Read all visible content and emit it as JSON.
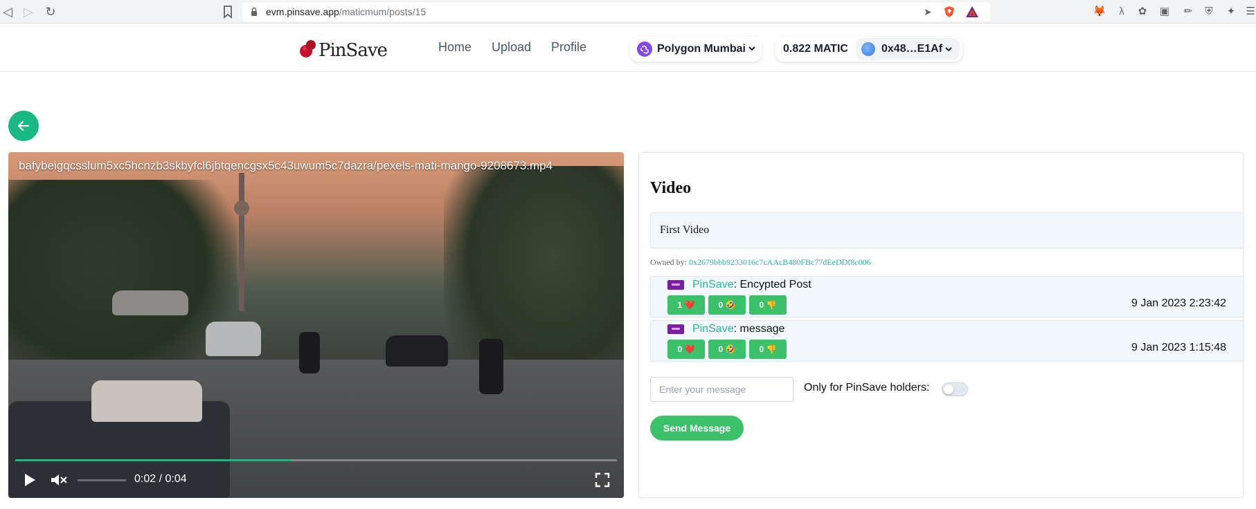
{
  "browser": {
    "url_host": "evm.pinsave.app",
    "url_path": "/maticmum/posts/15"
  },
  "header": {
    "logo_text": "PinSave",
    "nav": [
      {
        "label": "Home"
      },
      {
        "label": "Upload"
      },
      {
        "label": "Profile"
      }
    ],
    "network": "Polygon Mumbai",
    "balance": "0.822 MATIC",
    "account": "0x48…E1Af"
  },
  "video": {
    "filename": "bafybeigqcsslum5xc5hcnzb3skbyfcl6jbtqencgsx5c43uwum5c7dazra/pexels-mati-mango-9208673.mp4",
    "time": "0:02 / 0:04",
    "progress": 0.46
  },
  "post": {
    "title": "Video",
    "description": "First Video",
    "owned_by_label": "Owned by:",
    "owner": "0x2679bbb9233016c7cAAcB480FBc77dEeDDf8c006"
  },
  "messages": [
    {
      "sender": "PinSave",
      "text": ": Encypted Post",
      "date": "9 Jan 2023 2:23:42",
      "reactions": [
        {
          "count": "1",
          "emoji": "❤️"
        },
        {
          "count": "0",
          "emoji": "🤣"
        },
        {
          "count": "0",
          "emoji": "👎"
        }
      ]
    },
    {
      "sender": "PinSave",
      "text": ": message",
      "date": "9 Jan 2023 1:15:48",
      "reactions": [
        {
          "count": "0",
          "emoji": "❤️"
        },
        {
          "count": "0",
          "emoji": "🤣"
        },
        {
          "count": "0",
          "emoji": "👎"
        }
      ]
    }
  ],
  "composer": {
    "placeholder": "Enter your message",
    "holders_label": "Only for PinSave holders:",
    "holders_only": false,
    "send_label": "Send Message"
  },
  "colors": {
    "accent": "#1ab883",
    "button": "#3cc16b",
    "link": "#2db39a"
  }
}
